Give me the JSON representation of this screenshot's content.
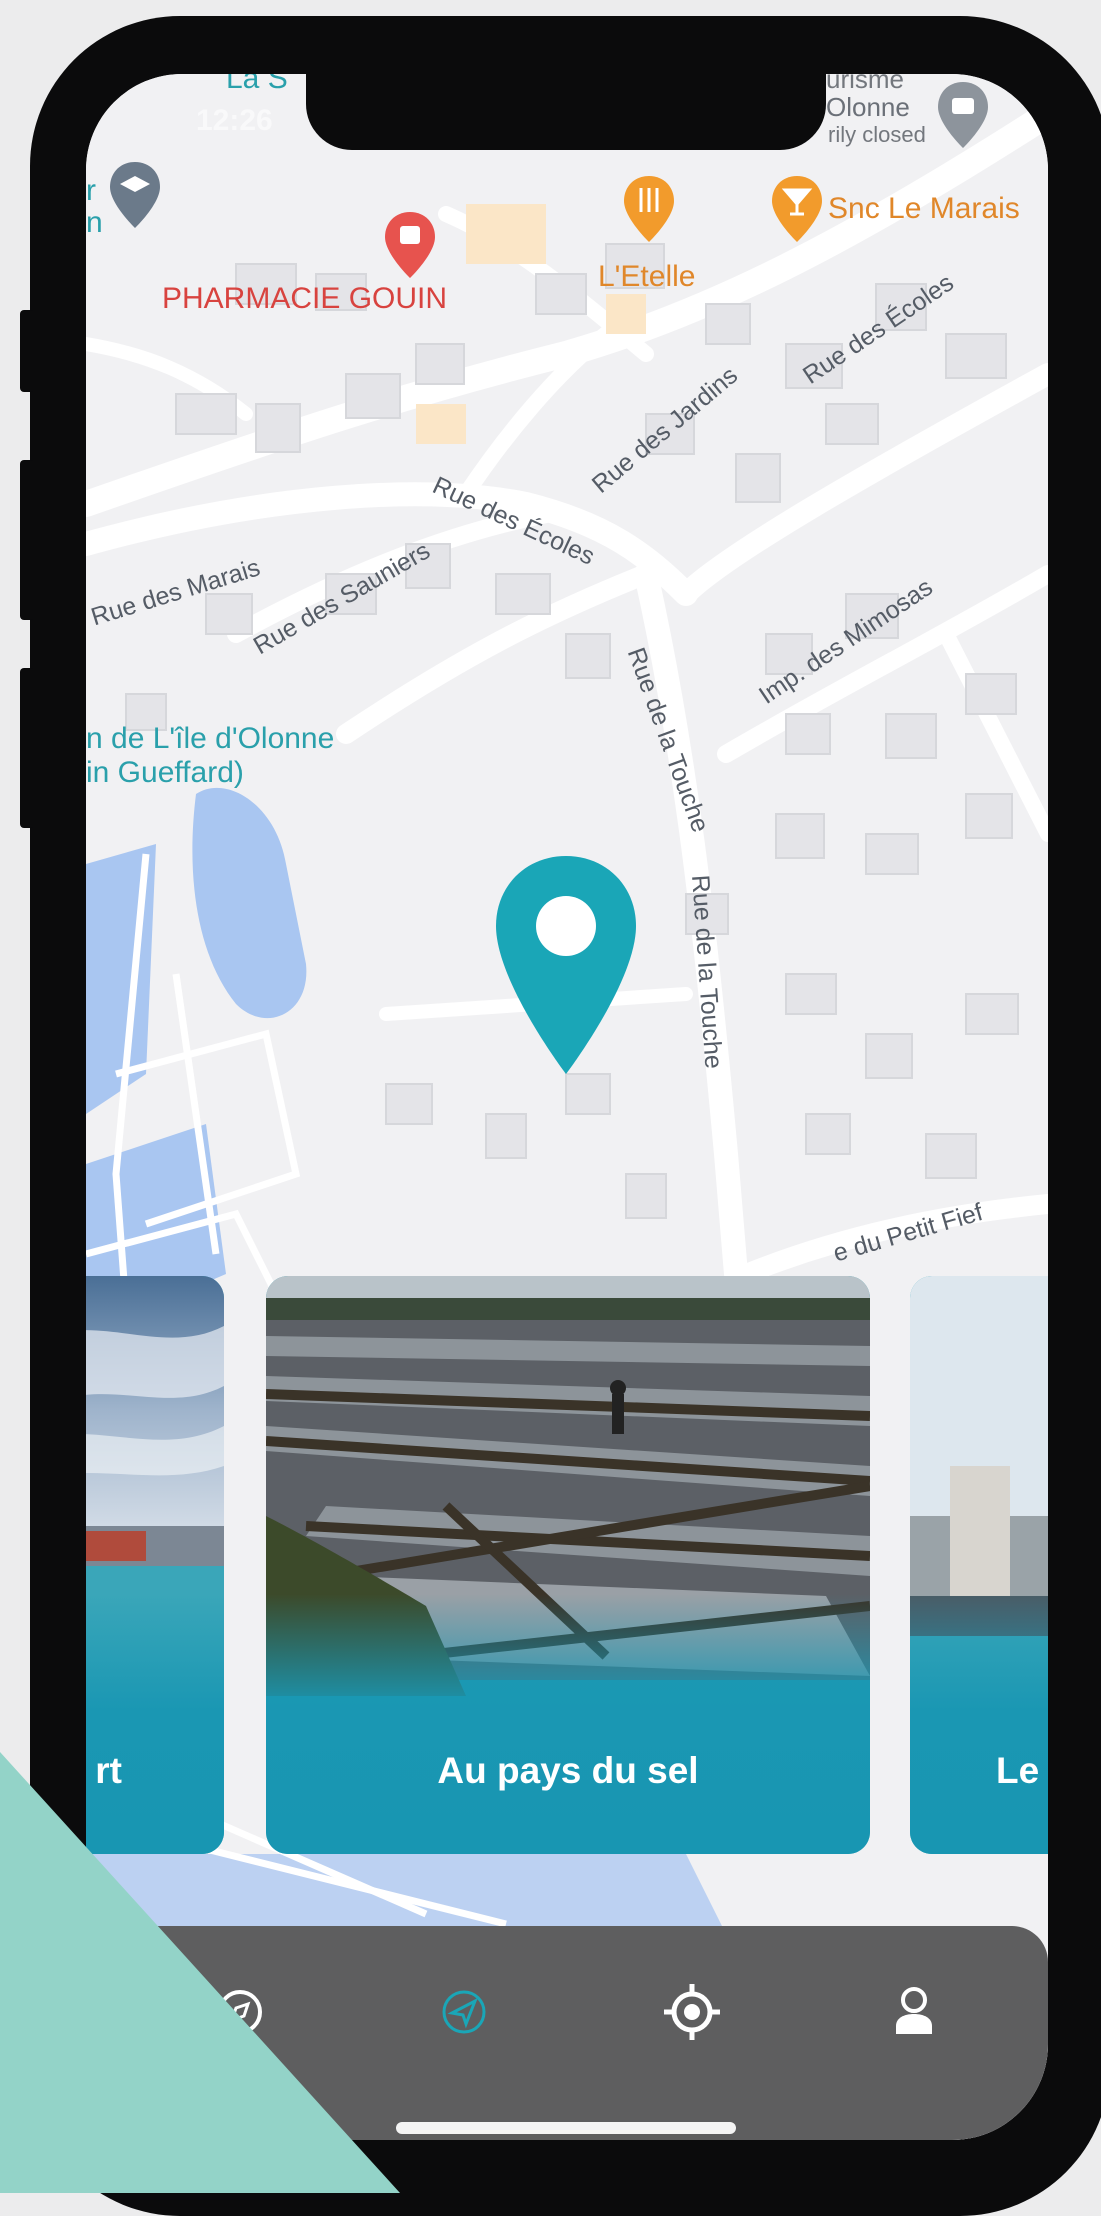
{
  "status_bar": {
    "time": "12:26"
  },
  "map": {
    "pois": {
      "pharmacie": "PHARMACIE GOUIN",
      "etelle": "L'Etelle",
      "snc": "Snc Le Marais",
      "salon_line1": "n de L'île d'Olonne",
      "salon_line2": "in Gueffard)",
      "olonne_top": "Olonne",
      "closed": "rily closed",
      "top_left_1": "r",
      "top_left_2": "n",
      "top_cut": "La S",
      "top_right_cut": "urisme"
    },
    "streets": {
      "rue_marais": "Rue des Marais",
      "rue_sauniers": "Rue des Sauniers",
      "rue_ecoles_1": "Rue des Écoles",
      "rue_ecoles_2": "Rue des Écoles",
      "rue_jardins": "Rue des Jardins",
      "rue_touche_1": "Rue de la Touche",
      "rue_touche_2": "Rue de la Touche",
      "imp_mimosas": "Imp. des Mimosas",
      "petit_fief": "e du Petit Fief"
    },
    "pin_color": "#1aa6b7"
  },
  "cards": [
    {
      "title": "rt"
    },
    {
      "title": "Au pays du sel"
    },
    {
      "title": "Le"
    }
  ],
  "tabbar": {
    "tabs": [
      {
        "icon": "compass-icon",
        "active": false
      },
      {
        "icon": "navigation-arrow-icon",
        "active": true
      },
      {
        "icon": "locate-target-icon",
        "active": false
      },
      {
        "icon": "user-icon",
        "active": false
      }
    ],
    "active_color": "#1aa6b7"
  },
  "colors": {
    "accent": "#1896b2",
    "corner_decoration": "#93d3c8",
    "water": "#a9c6f1"
  }
}
